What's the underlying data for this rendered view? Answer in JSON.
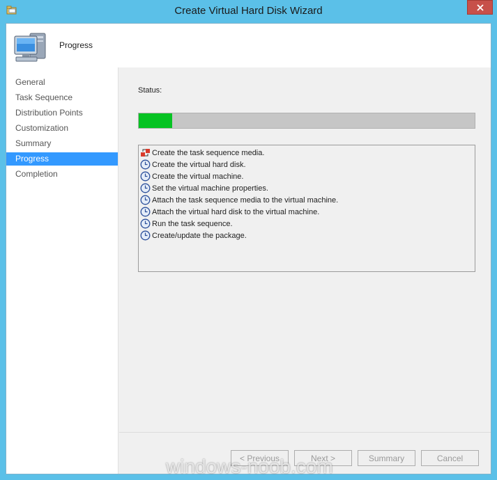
{
  "window": {
    "title": "Create Virtual Hard Disk Wizard"
  },
  "header": {
    "title": "Progress"
  },
  "nav": {
    "items": [
      {
        "label": "General",
        "active": false
      },
      {
        "label": "Task Sequence",
        "active": false
      },
      {
        "label": "Distribution Points",
        "active": false
      },
      {
        "label": "Customization",
        "active": false
      },
      {
        "label": "Summary",
        "active": false
      },
      {
        "label": "Progress",
        "active": true
      },
      {
        "label": "Completion",
        "active": false
      }
    ]
  },
  "status": {
    "label": "Status:",
    "progress": 0.1
  },
  "tasks": [
    {
      "label": "Create the task sequence media.",
      "icon": "in-progress-icon"
    },
    {
      "label": "Create the virtual hard disk.",
      "icon": "clock-icon"
    },
    {
      "label": "Create the virtual machine.",
      "icon": "clock-icon"
    },
    {
      "label": "Set the virtual machine properties.",
      "icon": "clock-icon"
    },
    {
      "label": "Attach the task sequence media to the virtual machine.",
      "icon": "clock-icon"
    },
    {
      "label": "Attach the virtual hard disk to the virtual machine.",
      "icon": "clock-icon"
    },
    {
      "label": "Run the task sequence.",
      "icon": "clock-icon"
    },
    {
      "label": "Create/update the package.",
      "icon": "clock-icon"
    }
  ],
  "buttons": {
    "previous": {
      "label": "< Previous",
      "enabled": false
    },
    "next": {
      "label": "Next >",
      "enabled": false
    },
    "summary": {
      "label": "Summary",
      "enabled": false
    },
    "cancel": {
      "label": "Cancel",
      "enabled": false
    }
  },
  "watermark": "windows-noob.com",
  "colors": {
    "progress_fill": "#06c323",
    "active_nav": "#3399ff",
    "titlebar": "#5bc0e8"
  }
}
